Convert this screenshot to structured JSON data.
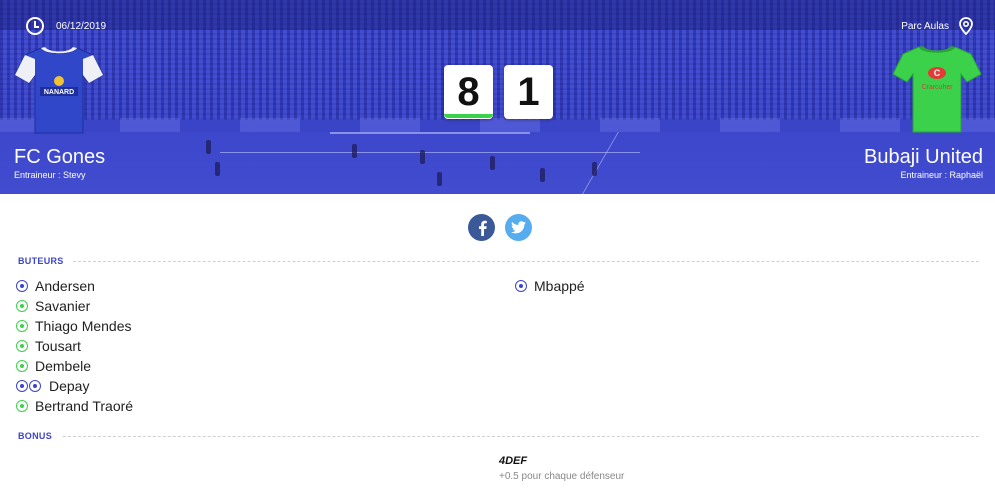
{
  "match": {
    "date": "06/12/2019",
    "venue": "Parc Aulas",
    "home": {
      "name": "FC Gones",
      "coach": "Entraineur : Stevy",
      "score": "8",
      "jersey_sponsor": "NANARD",
      "jersey_color": "#2f47c8"
    },
    "away": {
      "name": "Bubaji United",
      "coach": "Entraineur : Raphaël",
      "score": "1",
      "jersey_sponsor": "Crarcuher",
      "jersey_color": "#3bd14a"
    }
  },
  "colors": {
    "accent": "#3c45c9",
    "green": "#3bd14a",
    "facebook": "#3b5998",
    "twitter": "#55acee"
  },
  "share": {
    "facebook_icon": "facebook-icon",
    "twitter_icon": "twitter-icon"
  },
  "scorers_section": {
    "title": "BUTEURS",
    "home": [
      {
        "name": "Andersen",
        "balls": [
          "blue"
        ]
      },
      {
        "name": "Savanier",
        "balls": [
          "green"
        ]
      },
      {
        "name": "Thiago Mendes",
        "balls": [
          "green"
        ]
      },
      {
        "name": "Tousart",
        "balls": [
          "green"
        ]
      },
      {
        "name": "Dembele",
        "balls": [
          "green"
        ]
      },
      {
        "name": "Depay",
        "balls": [
          "blue",
          "blue"
        ]
      },
      {
        "name": "Bertrand Traoré",
        "balls": [
          "green"
        ]
      }
    ],
    "away": [
      {
        "name": "Mbappé",
        "balls": [
          "blue"
        ]
      }
    ]
  },
  "bonus_section": {
    "title": "BONUS",
    "name": "4DEF",
    "description": "+0.5 pour chaque défenseur"
  }
}
